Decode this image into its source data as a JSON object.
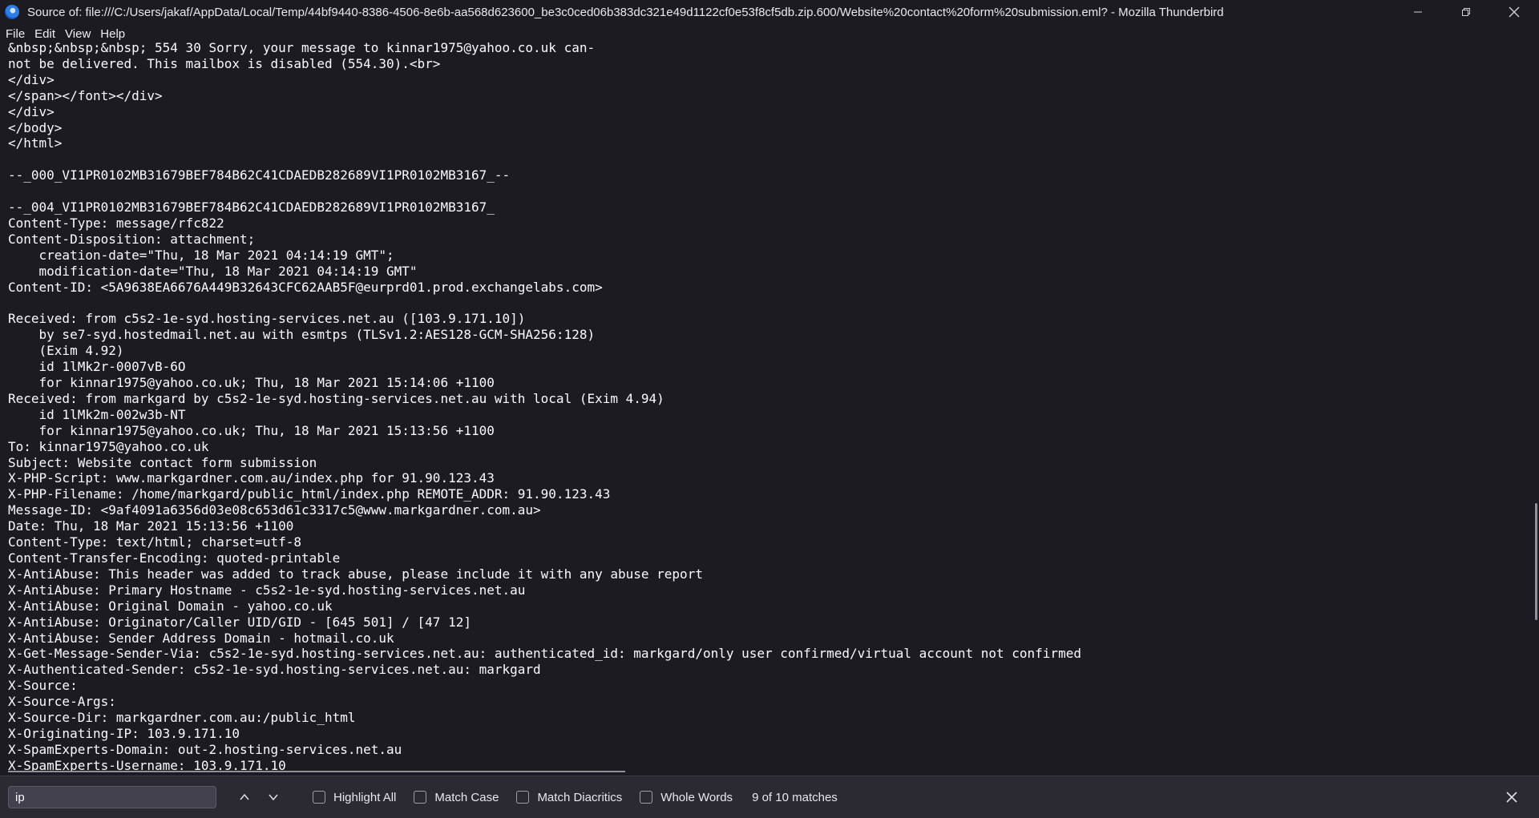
{
  "window": {
    "title": "Source of: file:///C:/Users/jakaf/AppData/Local/Temp/44bf9440-8386-4506-8e6b-aa568d623600_be3c0ced06b383dc321e49d1122cf0e53f8cf5db.zip.600/Website%20contact%20form%20submission.eml? - Mozilla Thunderbird",
    "icon": "thunderbird-app-icon",
    "controls": [
      "minimize-icon",
      "restore-icon",
      "close-icon"
    ]
  },
  "menu": {
    "file": "File",
    "edit": "Edit",
    "view": "View",
    "help": "Help"
  },
  "source": {
    "text": "&nbsp;&nbsp;&nbsp; 554 30 Sorry, your message to kinnar1975@yahoo.co.uk can-\nnot be delivered. This mailbox is disabled (554.30).<br>\n</div>\n</span></font></div>\n</div>\n</body>\n</html>\n\n--_000_VI1PR0102MB31679BEF784B62C41CDAEDB282689VI1PR0102MB3167_--\n\n--_004_VI1PR0102MB31679BEF784B62C41CDAEDB282689VI1PR0102MB3167_\nContent-Type: message/rfc822\nContent-Disposition: attachment;\n    creation-date=\"Thu, 18 Mar 2021 04:14:19 GMT\";\n    modification-date=\"Thu, 18 Mar 2021 04:14:19 GMT\"\nContent-ID: <5A9638EA6676A449B32643CFC62AAB5F@eurprd01.prod.exchangelabs.com>\n\nReceived: from c5s2-1e-syd.hosting-services.net.au ([103.9.171.10])\n    by se7-syd.hostedmail.net.au with esmtps (TLSv1.2:AES128-GCM-SHA256:128)\n    (Exim 4.92)\n    id 1lMk2r-0007vB-6O\n    for kinnar1975@yahoo.co.uk; Thu, 18 Mar 2021 15:14:06 +1100\nReceived: from markgard by c5s2-1e-syd.hosting-services.net.au with local (Exim 4.94)\n    id 1lMk2m-002w3b-NT\n    for kinnar1975@yahoo.co.uk; Thu, 18 Mar 2021 15:13:56 +1100\nTo: kinnar1975@yahoo.co.uk\nSubject: Website contact form submission\nX-PHP-Script: www.markgardner.com.au/index.php for 91.90.123.43\nX-PHP-Filename: /home/markgard/public_html/index.php REMOTE_ADDR: 91.90.123.43\nMessage-ID: <9af4091a6356d03e08c653d61c3317c5@www.markgardner.com.au>\nDate: Thu, 18 Mar 2021 15:13:56 +1100\nContent-Type: text/html; charset=utf-8\nContent-Transfer-Encoding: quoted-printable\nX-AntiAbuse: This header was added to track abuse, please include it with any abuse report\nX-AntiAbuse: Primary Hostname - c5s2-1e-syd.hosting-services.net.au\nX-AntiAbuse: Original Domain - yahoo.co.uk\nX-AntiAbuse: Originator/Caller UID/GID - [645 501] / [47 12]\nX-AntiAbuse: Sender Address Domain - hotmail.co.uk\nX-Get-Message-Sender-Via: c5s2-1e-syd.hosting-services.net.au: authenticated_id: markgard/only user confirmed/virtual account not confirmed\nX-Authenticated-Sender: c5s2-1e-syd.hosting-services.net.au: markgard\nX-Source: \nX-Source-Args: \nX-Source-Dir: markgardner.com.au:/public_html\nX-Originating-IP: 103.9.171.10\nX-SpamExperts-Domain: out-2.hosting-services.net.au\nX-SpamExperts-Username: 103.9.171.10"
  },
  "findbar": {
    "query": "ip",
    "highlight_all": "Highlight All",
    "match_case": "Match Case",
    "match_diacritics": "Match Diacritics",
    "whole_words": "Whole Words",
    "status": "9 of 10 matches"
  }
}
